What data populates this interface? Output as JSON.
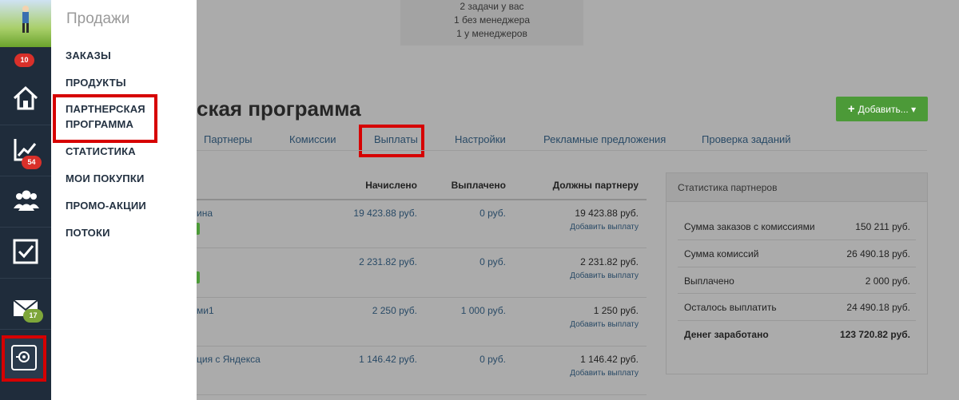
{
  "rail": {
    "badges": {
      "avatar": "10",
      "stats": "54",
      "mail": "17"
    }
  },
  "menu": {
    "title": "Продажи",
    "items": [
      "ЗАКАЗЫ",
      "ПРОДУКТЫ",
      "ПАРТНЕРСКАЯ",
      "ПРОГРАММА",
      "СТАТИСТИКА",
      "МОИ ПОКУПКИ",
      "ПРОМО-АКЦИИ",
      "ПОТОКИ"
    ]
  },
  "notice": [
    "2 задачи у вас",
    "1 без менеджера",
    "1 у менеджеров"
  ],
  "page": {
    "title": "ская программа",
    "add_button": "Добавить...",
    "tabs": [
      "Партнеры",
      "Комиссии",
      "Выплаты",
      "Настройки",
      "Рекламные предложения",
      "Проверка заданий"
    ]
  },
  "table": {
    "headers": {
      "accrued": "Начислено",
      "paid": "Выплачено",
      "owed": "Должны партнеру"
    },
    "add_payout": "Добавить выплату",
    "rows": [
      {
        "name": "ина",
        "accrued": "19 423.88 руб.",
        "paid": "0 руб.",
        "owed": "19 423.88 руб."
      },
      {
        "name": "",
        "accrued": "2 231.82 руб.",
        "paid": "0 руб.",
        "owed": "2 231.82 руб."
      },
      {
        "name": "ми1",
        "accrued": "2 250 руб.",
        "paid": "1 000 руб.",
        "owed": "1 250 руб."
      },
      {
        "name": "ция с Яндекса",
        "accrued": "1 146.42 руб.",
        "paid": "0 руб.",
        "owed": "1 146.42 руб."
      }
    ]
  },
  "stats": {
    "title": "Статистика партнеров",
    "rows": [
      {
        "label": "Сумма заказов с комиссиями",
        "value": "150 211 руб."
      },
      {
        "label": "Сумма комиссий",
        "value": "26 490.18 руб."
      },
      {
        "label": "Выплачено",
        "value": "2 000 руб."
      },
      {
        "label": "Осталось выплатить",
        "value": "24 490.18 руб."
      },
      {
        "label": "Денег заработано",
        "value": "123 720.82 руб."
      }
    ]
  }
}
